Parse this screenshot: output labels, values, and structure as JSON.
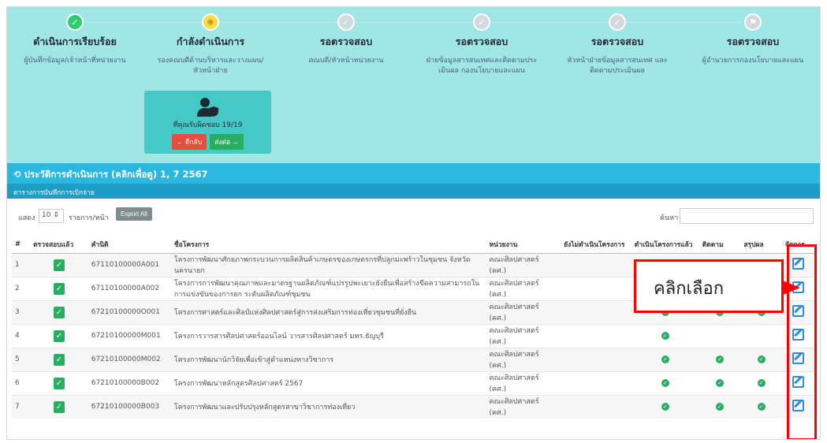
{
  "steps": [
    {
      "title": "ดำเนินการเรียบร้อย",
      "desc": "ผู้บันทึกข้อมูล/เจ้าหน้าที่หน่วยงาน",
      "state": "done"
    },
    {
      "title": "กำลังดำเนินการ",
      "desc": "รองคณบดีด้านบริหารและวางแผน/ หัวหน้าฝ่าย",
      "state": "active"
    },
    {
      "title": "รอตรวจสอบ",
      "desc": "คณบดี/หัวหน้าหน่วยงาน",
      "state": "pending"
    },
    {
      "title": "รอตรวจสอบ",
      "desc": "ฝ่ายข้อมูลสารสนเทศและติดตามประ เมินผล กองนโยบายและแผน",
      "state": "pending"
    },
    {
      "title": "รอตรวจสอบ",
      "desc": "หัวหน้าฝ่ายข้อมูลสารสนเทศ และ ติดตามประเมินผล",
      "state": "pending"
    },
    {
      "title": "รอตรวจสอบ",
      "desc": "ผู้อำนวยการกองนโยบายและแผน",
      "state": "final"
    }
  ],
  "action_card": {
    "note": "ที่คุณรับผิดชอบ 19/19",
    "back_label": "← ตีกลับ",
    "send_label": "ส่งต่อ →"
  },
  "history": {
    "title": "ประวัติการดำเนินการ (คลิกเพื่อดู) 1, 7 2567",
    "caption": "ตารางการบันทึกการเบิกจ่าย"
  },
  "controls": {
    "show_label": "แสดง",
    "length_value": "10",
    "per_page_label": "รายการ/หน้า",
    "export_label": "Export All",
    "search_label": "ค้นหา :",
    "search_value": ""
  },
  "table": {
    "headers": [
      "#",
      "ตรวจสอบแล้ว",
      "คำนิติ",
      "ชื่อโครงการ",
      "หน่วยงาน",
      "ยังไม่ดำเนินโครงการ",
      "ดำเนินโครงการแล้ว",
      "ติดตาม",
      "สรุปผล",
      "จัดการ"
    ],
    "rows": [
      {
        "no": "1",
        "code": "67110100000A001",
        "name": "โครงการพัฒนาศักยภาพกระบวนการผลิตสินค้าเกษตรของเกษตรกรที่ปลูกมะพร้าวในชุมชน จังหวัดนครนายก",
        "unit": "คณะศิลปศาสตร์ (คศ.)",
        "c1": false,
        "c2": true,
        "c3": false
      },
      {
        "no": "2",
        "code": "67110100000A002",
        "name": "โครงการการพัฒนาคุณภาพและมาตรฐานผลิตภัณฑ์แปรรูปพะเยาะยังยืนเพื่อสร้างขีดความสามารถในการแข่งขันของการยก ระดับผลิตภัณฑ์ชุมชน",
        "unit": "คณะศิลปศาสตร์ (คศ.)",
        "c1": false,
        "c2": true,
        "c3": false
      },
      {
        "no": "3",
        "code": "67210100000O001",
        "name": "โครงการศาสตร์และศิลป์แห่งศิลปศาสตร์สู่การส่งเสริมการท่องเที่ยวชุมชนที่ยั่งยืน",
        "unit": "คณะศิลปศาสตร์ (คศ.)",
        "c1": true,
        "c2": true,
        "c3": true
      },
      {
        "no": "4",
        "code": "67210100000M001",
        "name": "โครงการวารสารศิลปศาสตร์ออนไลน์ วารสารศิลปศาสตร์ มทร.ธัญบุรี",
        "unit": "คณะศิลปศาสตร์ (คศ.)",
        "c1": true,
        "c2": false,
        "c3": false
      },
      {
        "no": "5",
        "code": "67210100000M002",
        "name": "โครงการพัฒนานักวิจัยเพื่อเข้าสู่ตำแหน่งทางวิชาการ",
        "unit": "คณะศิลปศาสตร์ (คศ.)",
        "c1": true,
        "c2": true,
        "c3": true
      },
      {
        "no": "6",
        "code": "67210100000B002",
        "name": "โครงการพัฒนาหลักสูตรศิลปศาสตร์ 2567",
        "unit": "คณะศิลปศาสตร์ (คศ.)",
        "c1": true,
        "c2": true,
        "c3": true
      },
      {
        "no": "7",
        "code": "67210100000B003",
        "name": "โครงการพัฒนาและปรับปรุงหลักสูตรสาขาวิชาการท่องเที่ยว",
        "unit": "คณะศิลปศาสตร์ (คศ.)",
        "c1": true,
        "c2": true,
        "c3": true
      }
    ]
  },
  "annotation": {
    "callout_text": "คลิกเลือก"
  },
  "colors": {
    "steps_bg": "#9fe6e4",
    "history_bar": "#2ab7e0",
    "accent_red": "#ff0000",
    "ok_green": "#27ae60"
  }
}
